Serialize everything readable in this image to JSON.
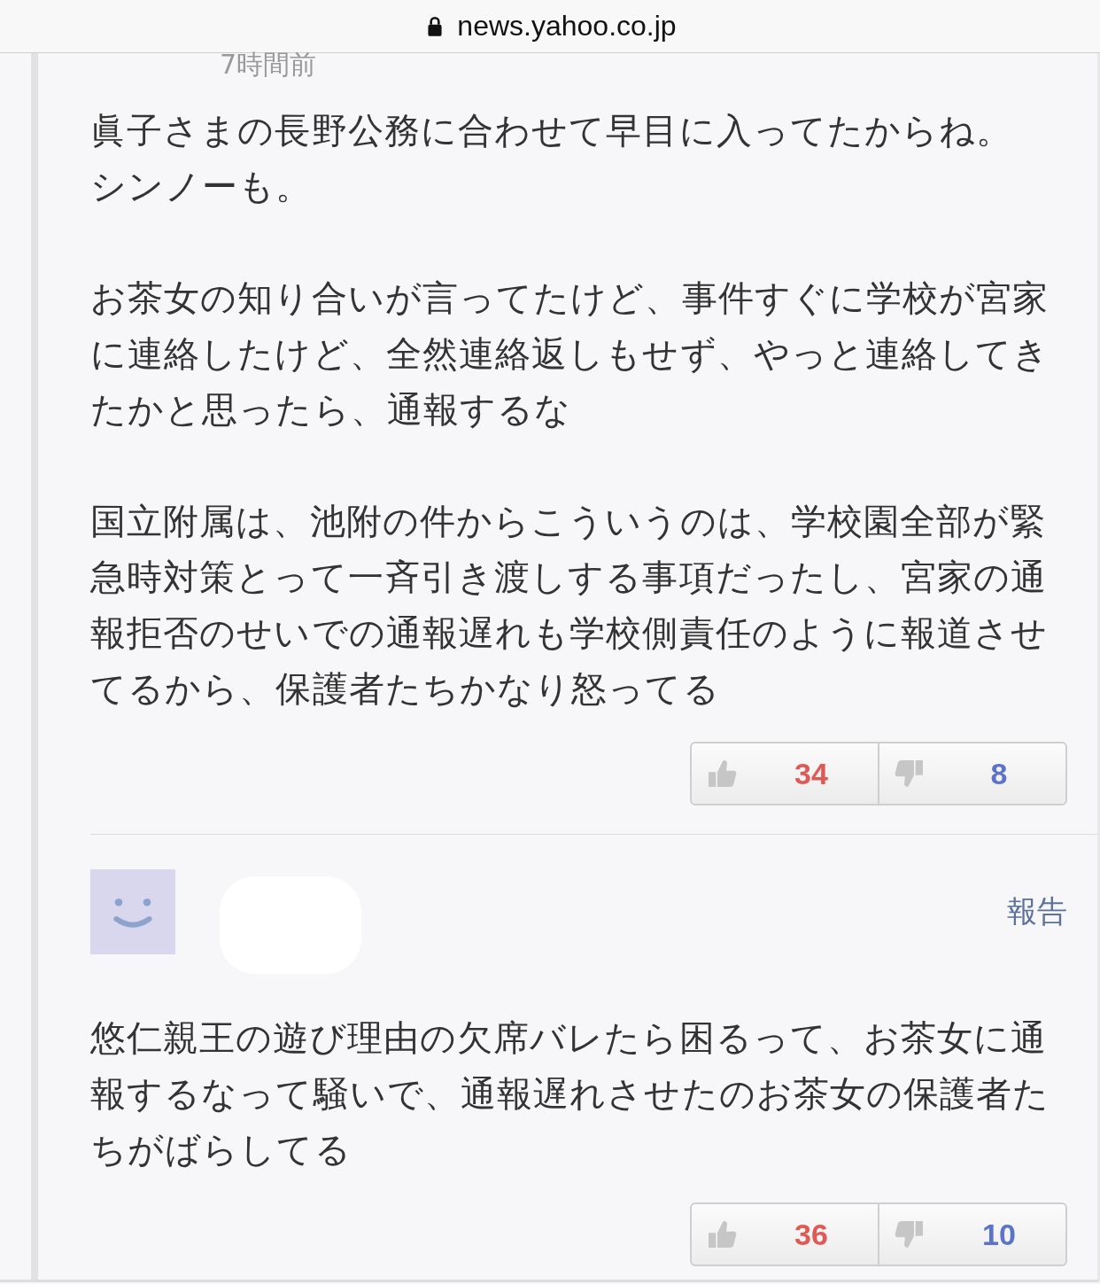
{
  "address_bar": {
    "url": "news.yahoo.co.jp",
    "secure": true
  },
  "comments": [
    {
      "timestamp": "7時間前",
      "paragraphs": [
        [
          "眞子さまの長野公務に合わせて早目に入ってたからね。",
          "シンノーも。"
        ],
        [
          "お茶女の知り合いが言ってたけど、事件すぐに学校が宮家に連絡したけど、全然連絡返しもせず、やっと連絡してきたかと思ったら、通報するな"
        ],
        [
          "国立附属は、池附の件からこういうのは、学校園全部が緊急時対策とって一斉引き渡しする事項だったし、宮家の通報拒否のせいでの通報遅れも学校側責任のように報道させてるから、保護者たちかなり怒ってる"
        ]
      ],
      "likes": "34",
      "dislikes": "8"
    },
    {
      "avatar": true,
      "report": "報告",
      "paragraphs": [
        [
          "悠仁親王の遊び理由の欠席バレたら困るって、お茶女に通報するなって騒いで、通報遅れさせたのお茶女の保護者たちがばらしてる"
        ]
      ],
      "likes": "36",
      "dislikes": "10"
    }
  ]
}
